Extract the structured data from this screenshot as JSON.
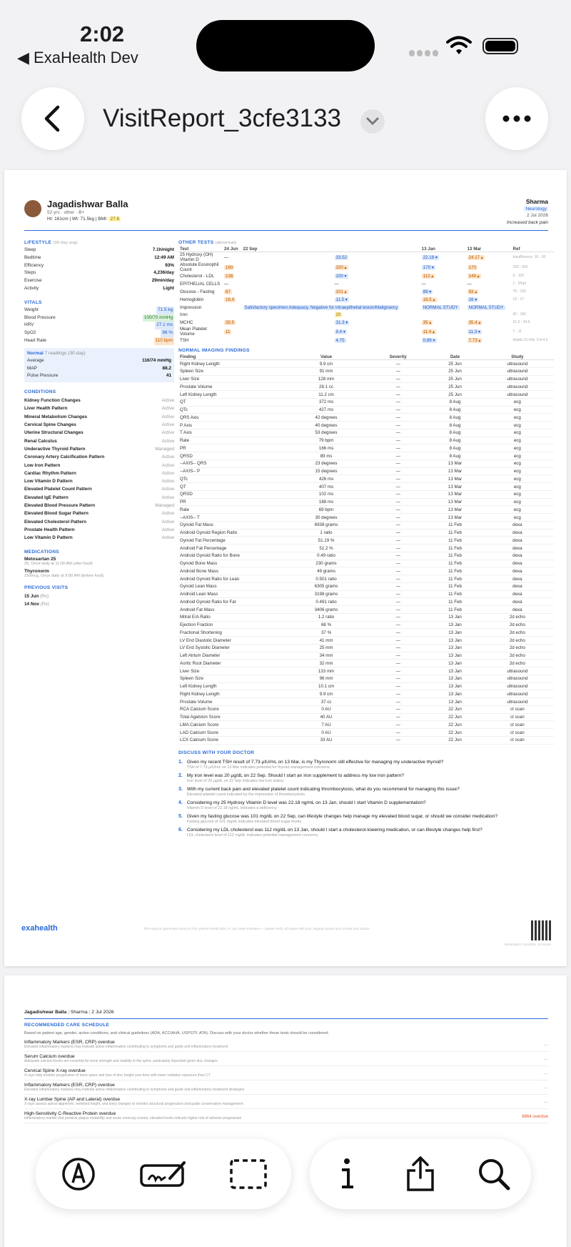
{
  "status": {
    "time": "2:02",
    "back_app": "◀ ExaHealth Dev"
  },
  "nav": {
    "title": "VisitReport_3cfe3133"
  },
  "patient": {
    "name": "Jagadishwar Balla",
    "sub": "52 yrs · other · B+",
    "vitals_line": "Ht: 161cm | Wt: 71.5kg | BMI:",
    "bmi": "27.6",
    "doctor": "Sharma",
    "specialty": "Neurology",
    "date": "2 Jul 2026",
    "complaint": "Increased back pain"
  },
  "lifestyle": {
    "title": "LIFESTYLE",
    "note": "(30-day avg)",
    "rows": [
      {
        "k": "Sleep",
        "v": "7.1h/night"
      },
      {
        "k": "Bedtime",
        "v": "12:49 AM"
      },
      {
        "k": "Efficiency",
        "v": "93%"
      },
      {
        "k": "Steps",
        "v": "4,236/day"
      },
      {
        "k": "Exercise",
        "v": "29min/day"
      },
      {
        "k": "Activity",
        "v": "Light"
      }
    ]
  },
  "vitals": {
    "title": "VITALS",
    "rows": [
      {
        "k": "Weight",
        "v": "71.5 kg"
      },
      {
        "k": "Blood Pressure",
        "v": "100/70 mmHg"
      },
      {
        "k": "HRV",
        "v": "27.1 ms"
      },
      {
        "k": "SpO2",
        "v": "96 %"
      },
      {
        "k": "Heart Rate",
        "v": "110 bpm"
      }
    ],
    "bp_box": {
      "status": "Normal",
      "note": "7 readings (30-day)",
      "rows": [
        {
          "k": "Average",
          "v": "116/74 mmHg"
        },
        {
          "k": "MAP",
          "v": "88.2"
        },
        {
          "k": "Pulse Pressure",
          "v": "41"
        }
      ]
    }
  },
  "conditions": {
    "title": "CONDITIONS",
    "rows": [
      {
        "k": "Kidney Function Changes",
        "v": "Active"
      },
      {
        "k": "Liver Health Pattern",
        "v": "Active"
      },
      {
        "k": "Mineral Metabolism Changes",
        "v": "Active"
      },
      {
        "k": "Cervical Spine Changes",
        "v": "Active"
      },
      {
        "k": "Uterine Structural Changes",
        "v": "Active"
      },
      {
        "k": "Renal Calculus",
        "v": "Active"
      },
      {
        "k": "Underactive Thyroid Pattern",
        "v": "Managed"
      },
      {
        "k": "Coronary Artery Calcification Pattern",
        "v": "Active"
      },
      {
        "k": "Low Iron Pattern",
        "v": "Active"
      },
      {
        "k": "Cardiac Rhythm Pattern",
        "v": "Active"
      },
      {
        "k": "Low Vitamin D Pattern",
        "v": "Active"
      },
      {
        "k": "Elevated Platelet Count Pattern",
        "v": "Active"
      },
      {
        "k": "Elevated IgE Pattern",
        "v": "Active"
      },
      {
        "k": "Elevated Blood Pressure Pattern",
        "v": "Managed"
      },
      {
        "k": "Elevated Blood Sugar Pattern",
        "v": "Active"
      },
      {
        "k": "Elevated Cholesterol Pattern",
        "v": "Active"
      },
      {
        "k": "Prostate Health Pattern",
        "v": "Active"
      },
      {
        "k": "Low Vitamin D Pattern",
        "v": "Active"
      }
    ]
  },
  "medications": {
    "title": "MEDICATIONS",
    "rows": [
      {
        "name": "Metosartan 25",
        "sig": "25, Once daily at 11:00 AM (after food)"
      },
      {
        "name": "Thyronorm",
        "sig": "150mcg, Once daily at 9:00 AM (before food)"
      }
    ]
  },
  "previous_visits": {
    "title": "PREVIOUS VISITS",
    "rows": [
      {
        "d": "15 Jun",
        "n": "(Rx)"
      },
      {
        "d": "14 Nov",
        "n": "(Rx)"
      }
    ]
  },
  "other_tests": {
    "title": "OTHER TESTS",
    "note": "(abnormal)",
    "cols": [
      "Test",
      "24 Jun",
      "22 Sep",
      "",
      "13 Jan",
      "13 Mar",
      "Ref"
    ],
    "rows": [
      {
        "t": "25 Hydroxy (OH) Vitamin D",
        "a": "—",
        "b": "33.52",
        "c": "22.18 ▾",
        "d": "24.17 ▴",
        "r": "Insufficiency: 10 - 30"
      },
      {
        "t": "Absolute Eosinophil Count",
        "a": "160",
        "b": "320 ▴",
        "c": "170 ▾",
        "d": "170",
        "r": "200 - 500"
      },
      {
        "t": "Cholesterol - LDL",
        "a": "138",
        "b": "100 ▾",
        "c": "112 ▴",
        "d": "149 ▴",
        "r": "0 - 100"
      },
      {
        "t": "EPITHELIAL CELLS",
        "a": "—",
        "b": "—",
        "c": "—",
        "d": "—",
        "r": "2 - 5/hpf"
      },
      {
        "t": "Glucose - Fasting",
        "a": "87",
        "b": "101 ▴",
        "c": "89 ▾",
        "d": "93 ▴",
        "r": "70 - 100"
      },
      {
        "t": "Hemoglobin",
        "a": "16.4",
        "b": "11.5 ▾",
        "c": "16.5 ▴",
        "d": "16 ▾",
        "r": "13 - 17"
      },
      {
        "t": "Impression",
        "a": "",
        "b": "Satisfactory specimen Adequacy. Negative for intraepithelial lesion/Malignancy",
        "c": "NORMAL STUDY",
        "d": "NORMAL STUDY",
        "r": ""
      },
      {
        "t": "Iron",
        "a": "",
        "b": "20",
        "c": "",
        "d": "",
        "r": "60 - 180"
      },
      {
        "t": "MCHC",
        "a": "35.5",
        "b": "31.3 ▾",
        "c": "35 ▴",
        "d": "35.4 ▴",
        "r": "31.5 - 34.5"
      },
      {
        "t": "Mean Platelet Volume",
        "a": "11",
        "b": "9.4 ▾",
        "c": "11.4 ▴",
        "d": "11.3 ▾",
        "r": "7 - 11"
      },
      {
        "t": "TSH",
        "a": "",
        "b": "4.75",
        "c": "0.89 ▾",
        "d": "7.73 ▴",
        "r": "Adults 21-54y: 0.4-4.2"
      }
    ]
  },
  "imaging": {
    "title": "NORMAL IMAGING FINDINGS",
    "cols": [
      "Finding",
      "Value",
      "Severity",
      "Date",
      "Study"
    ],
    "rows": [
      [
        "Right Kidney Length",
        "9.9 cm",
        "—",
        "25 Jun",
        "ultrasound"
      ],
      [
        "Spleen Size",
        "91 mm",
        "—",
        "25 Jun",
        "ultrasound"
      ],
      [
        "Liver Size",
        "128 mm",
        "—",
        "25 Jun",
        "ultrasound"
      ],
      [
        "Prostate Volume",
        "28.1 cc",
        "—",
        "25 Jun",
        "ultrasound"
      ],
      [
        "Left Kidney Length",
        "11.2 cm",
        "—",
        "25 Jun",
        "ultrasound"
      ],
      [
        "QT",
        "372 ms",
        "—",
        "8 Aug",
        "ecg"
      ],
      [
        "QTc",
        "427 ms",
        "—",
        "8 Aug",
        "ecg"
      ],
      [
        "QRS Axis",
        "42 degrees",
        "—",
        "8 Aug",
        "ecg"
      ],
      [
        "P Axis",
        "40 degrees",
        "—",
        "8 Aug",
        "ecg"
      ],
      [
        "T Axis",
        "53 degrees",
        "—",
        "8 Aug",
        "ecg"
      ],
      [
        "Rate",
        "79 bpm",
        "—",
        "8 Aug",
        "ecg"
      ],
      [
        "PR",
        "166 ms",
        "—",
        "8 Aug",
        "ecg"
      ],
      [
        "QRSD",
        "89 ms",
        "—",
        "8 Aug",
        "ecg"
      ],
      [
        "--AXIS-- QRS",
        "23 degrees",
        "—",
        "13 Mar",
        "ecg"
      ],
      [
        "--AXIS-- P",
        "15 degrees",
        "—",
        "13 Mar",
        "ecg"
      ],
      [
        "QTc",
        "426 ms",
        "—",
        "13 Mar",
        "ecg"
      ],
      [
        "QT",
        "407 ms",
        "—",
        "13 Mar",
        "ecg"
      ],
      [
        "QRSD",
        "102 ms",
        "—",
        "13 Mar",
        "ecg"
      ],
      [
        "PR",
        "168 ms",
        "—",
        "13 Mar",
        "ecg"
      ],
      [
        "Rate",
        "69 bpm",
        "—",
        "13 Mar",
        "ecg"
      ],
      [
        "--AXIS-- T",
        "30 degrees",
        "—",
        "13 Mar",
        "ecg"
      ],
      [
        "Gynoid Fat Mass",
        "6938 grams",
        "—",
        "11 Feb",
        "dexa"
      ],
      [
        "Android Gynoid Region Ratio",
        "1 ratio",
        "—",
        "11 Feb",
        "dexa"
      ],
      [
        "Gynoid Fat Percentage",
        "51.19 %",
        "—",
        "11 Feb",
        "dexa"
      ],
      [
        "Android Fat Percentage",
        "51.2 %",
        "—",
        "11 Feb",
        "dexa"
      ],
      [
        "Android Gynoid Ratio for Bone",
        "0.49 ratio",
        "—",
        "11 Feb",
        "dexa"
      ],
      [
        "Gynoid Bone Mass",
        "230 grams",
        "—",
        "11 Feb",
        "dexa"
      ],
      [
        "Android Bone Mass",
        "49 grams",
        "—",
        "11 Feb",
        "dexa"
      ],
      [
        "Android Gynoid Ratio for Lean",
        "0.501 ratio",
        "—",
        "11 Feb",
        "dexa"
      ],
      [
        "Gynoid Lean Mass",
        "6305 grams",
        "—",
        "11 Feb",
        "dexa"
      ],
      [
        "Android Lean Mass",
        "3198 grams",
        "—",
        "11 Feb",
        "dexa"
      ],
      [
        "Android Gynoid Ratio for Fat",
        "0.491 ratio",
        "—",
        "11 Feb",
        "dexa"
      ],
      [
        "Android Fat Mass",
        "3406 grams",
        "—",
        "11 Feb",
        "dexa"
      ],
      [
        "Mitral E/A Ratio",
        "1.2 ratio",
        "—",
        "13 Jan",
        "2d echo"
      ],
      [
        "Ejection Fraction",
        "68 %",
        "—",
        "13 Jan",
        "2d echo"
      ],
      [
        "Fractional Shortening",
        "37 %",
        "—",
        "13 Jan",
        "2d echo"
      ],
      [
        "LV End Diastolic Diameter",
        "41 mm",
        "—",
        "13 Jan",
        "2d echo"
      ],
      [
        "LV End Systolic Diameter",
        "25 mm",
        "—",
        "13 Jan",
        "2d echo"
      ],
      [
        "Left Atrium Diameter",
        "34 mm",
        "—",
        "13 Jan",
        "2d echo"
      ],
      [
        "Aortic Root Diameter",
        "32 mm",
        "—",
        "13 Jan",
        "2d echo"
      ],
      [
        "Liver Size",
        "133 mm",
        "—",
        "13 Jan",
        "ultrasound"
      ],
      [
        "Spleen Size",
        "96 mm",
        "—",
        "13 Jan",
        "ultrasound"
      ],
      [
        "Left Kidney Length",
        "10.1 cm",
        "—",
        "13 Jan",
        "ultrasound"
      ],
      [
        "Right Kidney Length",
        "9.9 cm",
        "—",
        "13 Jan",
        "ultrasound"
      ],
      [
        "Prostate Volume",
        "37 cc",
        "—",
        "13 Jan",
        "ultrasound"
      ],
      [
        "RCA Calcium Score",
        "0 AU",
        "—",
        "22 Jun",
        "ct scan"
      ],
      [
        "Total Agatston Score",
        "40 AU",
        "—",
        "22 Jun",
        "ct scan"
      ],
      [
        "LMA Calcium Score",
        "7 AU",
        "—",
        "22 Jun",
        "ct scan"
      ],
      [
        "LAD Calcium Score",
        "0 AU",
        "—",
        "22 Jun",
        "ct scan"
      ],
      [
        "LCX Calcium Score",
        "33 AU",
        "—",
        "22 Jun",
        "ct scan"
      ]
    ]
  },
  "discuss": {
    "title": "DISCUSS WITH YOUR DOCTOR",
    "rows": [
      {
        "q": "Given my recent TSH result of 7.73 µIU/mL on 13 Mar, is my Thyronorm still effective for managing my underactive thyroid?",
        "s": "TSH of 7.73 µIU/mL on 13 Mar indicates potential for thyroid management concerns."
      },
      {
        "q": "My iron level was 20 µg/dL on 22 Sep. Should I start an iron supplement to address my low iron pattern?",
        "s": "Iron level of 20 µg/dL on 22 Sep indicates low iron status."
      },
      {
        "q": "With my current back pain and elevated platelet count indicating thrombocytosis, what do you recommend for managing this issue?",
        "s": "Elevated platelet count indicated by the impression of thrombocytosis."
      },
      {
        "q": "Considering my 25 Hydroxy Vitamin D level was 22.18 ng/mL on 13 Jan, should I start Vitamin D supplementation?",
        "s": "Vitamin D level of 22.18 ng/mL indicates a deficiency."
      },
      {
        "q": "Given my fasting glucose was 101 mg/dL on 22 Sep, can lifestyle changes help manage my elevated blood sugar, or should we consider medication?",
        "s": "Fasting glucose of 101 mg/dL indicates elevated blood sugar levels."
      },
      {
        "q": "Considering my LDL cholesterol was 112 mg/dL on 13 Jan, should I start a cholesterol-lowering medication, or can lifestyle changes help first?",
        "s": "LDL cholesterol level of 112 mg/dL indicates potential management concerns."
      }
    ]
  },
  "footer": {
    "logo": "exahealth",
    "note": "This report is generated using AI from patient health data. AI can make mistakes — please verify all values with your original reports and consult your doctor.",
    "generated": "Generated 2 Jul 2026, 12:44 pm"
  },
  "page2": {
    "header_name": "Jagadishwar Balla",
    "header_doctor": "Sharma",
    "header_date": "2 Jul 2026",
    "care_title": "RECOMMENDED CARE SCHEDULE",
    "care_intro": "Based on patient age, gender, active conditions, and clinical guidelines (ADA, ACC/AHA, USPSTF, ATA). Discuss with your doctor whether these tests should be considered.",
    "items": [
      {
        "t": "Inflammatory Markers (ESR, CRP) overdue",
        "s": "Elevated inflammatory markers may indicate active inflammation contributing to symptoms and guide anti-inflammatory treatment",
        "r": "—"
      },
      {
        "t": "Serum Calcium overdue",
        "s": "Adequate calcium levels are essential for bone strength and stability in the spine, particularly important given disc changes",
        "r": "—"
      },
      {
        "t": "Cervical Spine X-ray overdue",
        "s": "X-rays help monitor progression of bone spurs and loss of disc height over time with lower radiation exposure than CT",
        "r": "—"
      },
      {
        "t": "Inflammatory Markers (ESR, CRP) overdue",
        "s": "Elevated inflammatory markers may indicate active inflammation contributing to symptoms and guide anti-inflammatory treatment strategies",
        "r": "—"
      },
      {
        "t": "X-ray Lumbar Spine (AP and Lateral) overdue",
        "s": "X-rays assess spinal alignment, vertebral height, and bony changes to monitor structural progression and guide conservative management",
        "r": "—"
      },
      {
        "t": "High-Sensitivity C-Reactive Protein overdue",
        "s": "Inflammatory marker that predicts plaque instability and acute coronary events; elevated levels indicate higher risk of adverse progression",
        "r": "6864 overdue"
      }
    ]
  },
  "toolbar": {
    "markup": "markup-icon",
    "signature": "signature-icon",
    "select": "selection-icon",
    "info": "info-icon",
    "share": "share-icon",
    "search": "search-icon"
  },
  "colors": {
    "accent": "#2a6ad8",
    "flag_low": "#dde8fb",
    "flag_high": "#fde3c8",
    "flag_ok": "#d9f2d9"
  }
}
